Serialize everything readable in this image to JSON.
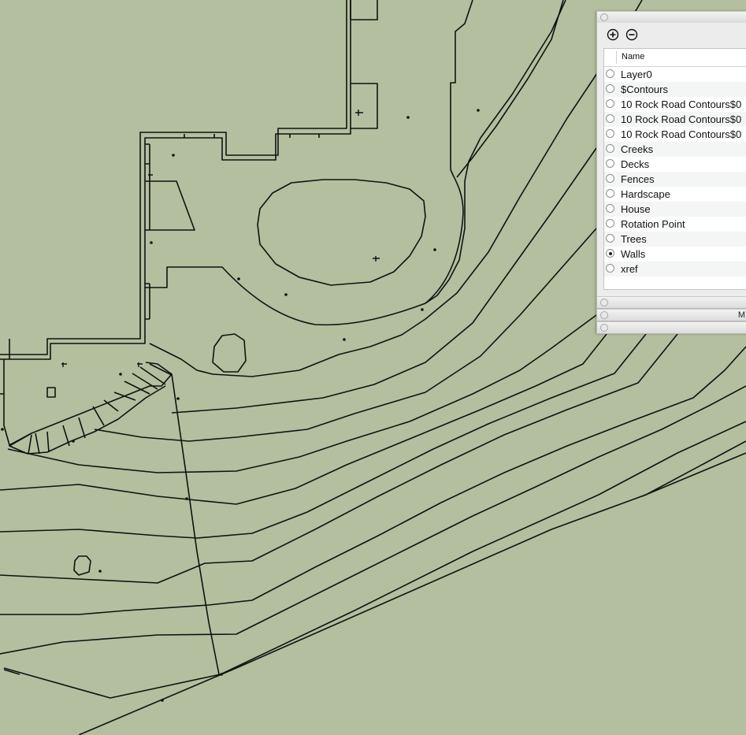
{
  "panel": {
    "bottom_title_fragment": "M",
    "list_header": "Name",
    "layers": [
      {
        "name": "Layer0",
        "active": false
      },
      {
        "name": "$Contours",
        "active": false
      },
      {
        "name": "10 Rock Road Contours$0",
        "active": false
      },
      {
        "name": "10 Rock Road Contours$0",
        "active": false
      },
      {
        "name": "10 Rock Road Contours$0",
        "active": false
      },
      {
        "name": "Creeks",
        "active": false
      },
      {
        "name": "Decks",
        "active": false
      },
      {
        "name": "Fences",
        "active": false
      },
      {
        "name": "Hardscape",
        "active": false
      },
      {
        "name": "House",
        "active": false
      },
      {
        "name": "Rotation Point",
        "active": false
      },
      {
        "name": "Trees",
        "active": false
      },
      {
        "name": "Walls",
        "active": true
      },
      {
        "name": "xref",
        "active": false
      }
    ],
    "toolbar": {
      "add_icon": "plus-circle-icon",
      "remove_icon": "minus-circle-icon"
    }
  },
  "colors": {
    "canvas_bg": "#b3bf9f",
    "line": "#111111",
    "panel_bg": "#ececec"
  }
}
